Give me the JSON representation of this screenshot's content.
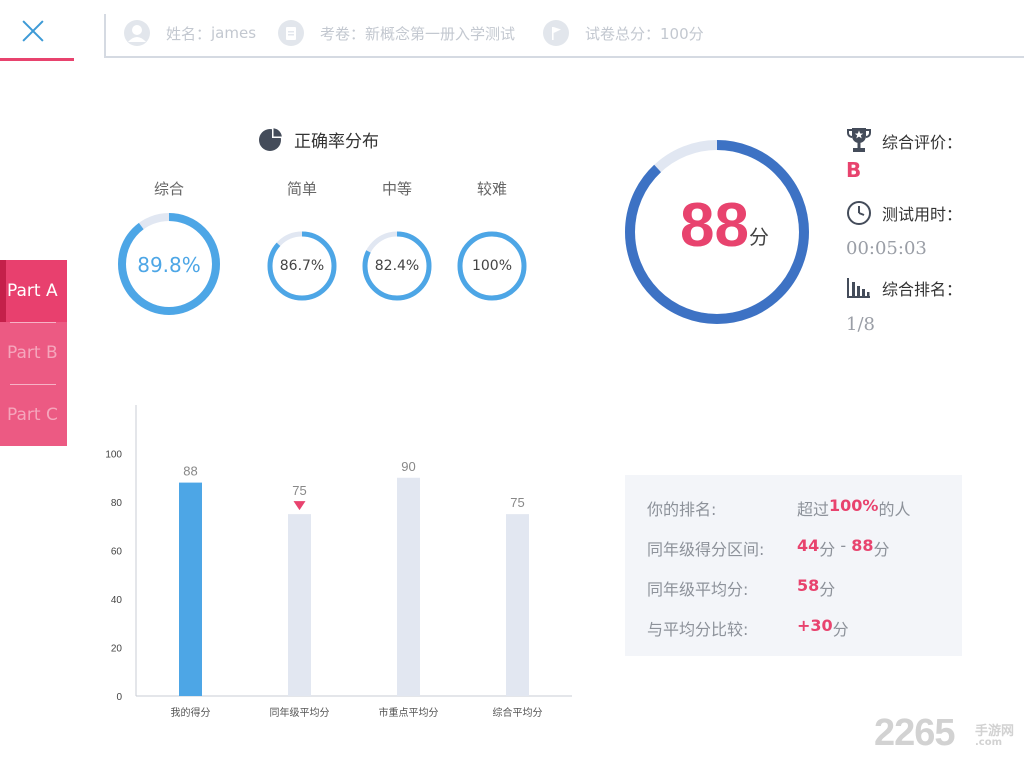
{
  "header": {
    "name_label": "姓名：",
    "name_value": "james",
    "paper_label": "考卷：",
    "paper_value": "新概念第一册入学测试",
    "total_label": "试卷总分：",
    "total_value": "100分"
  },
  "sidebar": {
    "tabs": [
      {
        "label": "Part A",
        "active": true
      },
      {
        "label": "Part B",
        "active": false
      },
      {
        "label": "Part C",
        "active": false
      }
    ]
  },
  "accuracy": {
    "title": "正确率分布",
    "rings": [
      {
        "label": "综合",
        "value_text": "89.8%",
        "fraction": 0.898
      },
      {
        "label": "简单",
        "value_text": "86.7%",
        "fraction": 0.867
      },
      {
        "label": "中等",
        "value_text": "82.4%",
        "fraction": 0.824
      },
      {
        "label": "较难",
        "value_text": "100%",
        "fraction": 1.0
      }
    ]
  },
  "score": {
    "value": "88",
    "unit": "分",
    "fraction": 0.88,
    "rating_label": "综合评价：",
    "rating_value": "B",
    "time_label": "测试用时：",
    "time_value": "00:05:03",
    "rank_label": "综合排名：",
    "rank_value": "1/8"
  },
  "chart_data": {
    "type": "bar",
    "categories": [
      "我的得分",
      "同年级平均分",
      "市重点平均分",
      "综合平均分"
    ],
    "values": [
      88,
      75,
      90,
      75
    ],
    "ylim": [
      0,
      120
    ],
    "yticks": [
      0,
      20,
      40,
      60,
      80,
      100
    ],
    "xlabel": "",
    "ylabel": "",
    "grid": false,
    "highlight_index": 0,
    "marker_index": 1
  },
  "stats": {
    "rank_label": "你的排名:",
    "rank_prefix": "超过",
    "rank_value": "100%",
    "rank_suffix": "的人",
    "range_label": "同年级得分区间:",
    "range_low": "44",
    "range_unit": "分",
    "range_sep": " - ",
    "range_high": "88",
    "avg_label": "同年级平均分:",
    "avg_value": "58",
    "avg_unit": "分",
    "diff_label": "与平均分比较:",
    "diff_value": "+30",
    "diff_unit": "分"
  },
  "watermark": {
    "number": "2265",
    "site": "手游网",
    "url": ".com"
  },
  "colors": {
    "accent_pink": "#e8436e",
    "ring_blue": "#4da6e6",
    "score_blue": "#3d72c4",
    "bar_blue": "#4da6e6",
    "bar_gray": "#e2e7f1",
    "track": "#e1e7f2"
  },
  "icons": {
    "close": "close-icon",
    "user": "user-icon",
    "paper": "paper-icon",
    "flag": "flag-icon",
    "pie": "pie-chart-icon",
    "trophy": "trophy-icon",
    "clock": "clock-icon",
    "rank": "bar-rank-icon"
  }
}
